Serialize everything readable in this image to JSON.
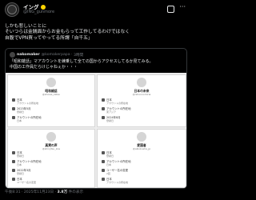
{
  "post": {
    "display_name": "イング",
    "handle": "@ING_gunmore",
    "body": "しかも悲しいことに\nそいつらは金銭面からお金もらって工作してるわけではなく\n自腹でVPN買ってやってる所謂「自千五」",
    "footer": {
      "time": "午後8:31 · 2025年11月23日",
      "views_count": "3.8万",
      "views_label": "件の表示"
    }
  },
  "quote": {
    "name": "nakomaker",
    "handle": "@komakerpapa",
    "age": "3時間",
    "text": "「昭和雑話」マアカウントを練乗して全ての国からアクセスしてるか見てみる。\n中国の工作員だらけじゃねぇか・・・",
    "panels": [
      {
        "name": "昭和維話",
        "handle": "@showa_zatsu",
        "rows": [
          {
            "label": "日本",
            "sub": "アカウントの所在地"
          },
          {
            "label": "2023年5月",
            "sub": "登録日"
          },
          {
            "label": "アカウントの所在地",
            "sub": "日本"
          }
        ]
      },
      {
        "name": "日本の未来",
        "handle": "@nihonnomirai",
        "rows": [
          {
            "label": "日本",
            "sub": "アカウントの所在地"
          },
          {
            "label": "アカウントの所在地",
            "sub": "東アジア"
          },
          {
            "label": "2024年8月",
            "sub": "登録日"
          }
        ]
      },
      {
        "name": "真実の声",
        "handle": "@shinjitsu_koe",
        "rows": [
          {
            "label": "日本",
            "sub": "登録日"
          },
          {
            "label": "アカウントの所在地",
            "sub": "日本"
          },
          {
            "label": "2022年3月",
            "sub": "登録日"
          },
          {
            "label": "日本",
            "sub": "ユーザー名の変更"
          }
        ]
      },
      {
        "name": "愛国者",
        "handle": "@aikokusha_jp",
        "rows": [
          {
            "label": "日本",
            "sub": "登録日"
          },
          {
            "label": "アカウントの所在地",
            "sub": "日本"
          },
          {
            "label": "ユーザー名の変更",
            "sub": "2回"
          },
          {
            "label": "日本",
            "sub": "アカウントの所在地"
          }
        ]
      }
    ]
  },
  "icons": {
    "verified": "verified-badge-icon",
    "grok": "grok-icon",
    "more": "more-icon"
  }
}
